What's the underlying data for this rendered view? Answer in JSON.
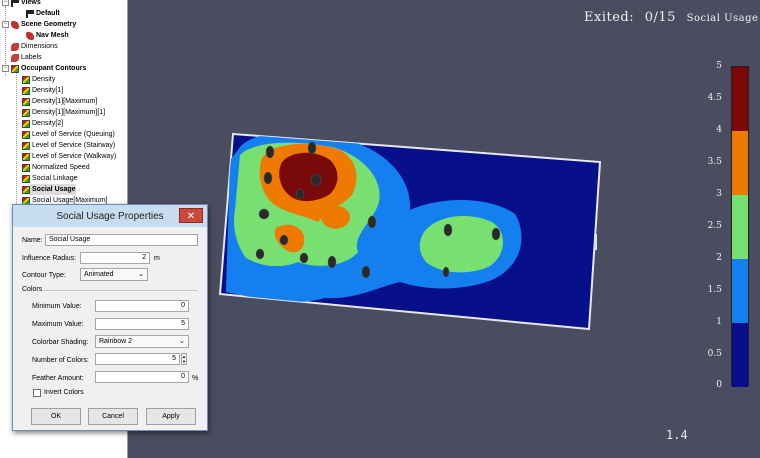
{
  "tree": {
    "items": [
      {
        "label": "Views",
        "bold": true
      },
      {
        "label": "Default",
        "bold": true
      },
      {
        "label": "Scene Geometry",
        "bold": true
      },
      {
        "label": "Nav Mesh",
        "bold": true
      },
      {
        "label": "Dimensions"
      },
      {
        "label": "Labels"
      },
      {
        "label": "Occupant Contours",
        "bold": true
      },
      {
        "label": "Density"
      },
      {
        "label": "Density[1]"
      },
      {
        "label": "Density[1][Maximum]"
      },
      {
        "label": "Density[1][Maximum][1]"
      },
      {
        "label": "Density[2]"
      },
      {
        "label": "Level of Service (Queuing)"
      },
      {
        "label": "Level of Service (Stairway)"
      },
      {
        "label": "Level of Service (Walkway)"
      },
      {
        "label": "Normalized Speed"
      },
      {
        "label": "Social Linkage"
      },
      {
        "label": "Social Usage",
        "bold": true,
        "selected": true
      },
      {
        "label": "Social Usage[Maximum]"
      }
    ]
  },
  "viewport": {
    "status_label": "Exited:",
    "status_value": "0/15",
    "contour_name": "Social Usage",
    "version": "1.4"
  },
  "colorbar": {
    "ticks": [
      "5",
      "4.5",
      "4",
      "3.5",
      "3",
      "2.5",
      "2",
      "1.5",
      "1",
      "0.5",
      "0"
    ],
    "colors": [
      "#7a0a0a",
      "#f07a00",
      "#78e070",
      "#1480f0",
      "#07108a"
    ]
  },
  "dialog": {
    "title": "Social Usage Properties",
    "close_symbol": "✕",
    "name_label": "Name:",
    "name_value": "Social Usage",
    "radius_label": "Influence Radius:",
    "radius_value": "2",
    "radius_unit": "m",
    "contour_type_label": "Contour Type:",
    "contour_type_value": "Animated",
    "colors_group": "Colors",
    "min_label": "Minimum Value:",
    "min_value": "0",
    "max_label": "Maximum Value:",
    "max_value": "5",
    "shading_label": "Colorbar Shading:",
    "shading_value": "Rainbow 2",
    "num_colors_label": "Number of Colors:",
    "num_colors_value": "5",
    "feather_label": "Feather Amount:",
    "feather_value": "0",
    "feather_unit": "%",
    "invert_label": "Invert Colors",
    "ok_label": "OK",
    "cancel_label": "Cancel",
    "apply_label": "Apply"
  }
}
